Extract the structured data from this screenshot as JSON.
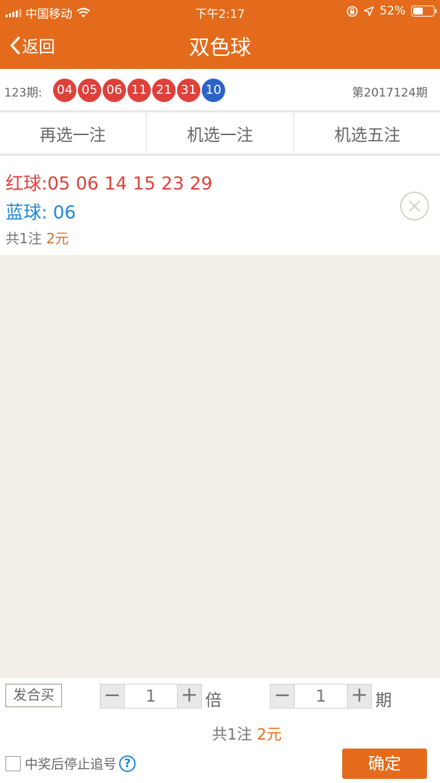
{
  "status_bar": {
    "carrier": "中国移动",
    "time": "下午2:17",
    "battery_text": "52%",
    "battery_level": 0.52
  },
  "nav": {
    "back_label": "返回",
    "title": "双色球"
  },
  "draw": {
    "label": "123期:",
    "red_balls": [
      "04",
      "05",
      "06",
      "11",
      "21",
      "31"
    ],
    "blue_ball": "10",
    "next_period": "第2017124期"
  },
  "actions": [
    "再选一注",
    "机选一注",
    "机选五注"
  ],
  "ticket": {
    "red_text": "红球:05 06 14 15 23 29",
    "blue_text": "蓝球: 06",
    "count_prefix": "共1注",
    "amount": "2元"
  },
  "bottom": {
    "hemai_label": "发合买",
    "multiple_value": "1",
    "multiple_unit": "倍",
    "period_value": "1",
    "period_unit": "期",
    "summary_prefix": "共1注",
    "summary_amount": "2元",
    "stop_label": "中奖后停止追号",
    "help_glyph": "?",
    "confirm_label": "确定"
  },
  "colors": {
    "brand_orange": "#e46b1b",
    "red_ball": "#e0403a",
    "blue_ball": "#2b63c9",
    "blue_text": "#1e87d6"
  }
}
